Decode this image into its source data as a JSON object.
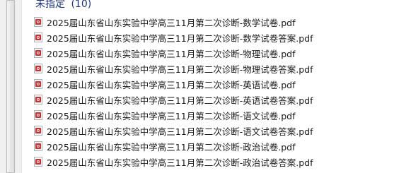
{
  "group": {
    "label": "未指定",
    "count": "(10)"
  },
  "files": [
    {
      "name": "2025届山东省山东实验中学高三11月第二次诊断-数学试卷.pdf",
      "icon": "pdf-file-icon"
    },
    {
      "name": "2025届山东省山东实验中学高三11月第二次诊断-数学试卷答案.pdf",
      "icon": "pdf-file-icon"
    },
    {
      "name": "2025届山东省山东实验中学高三11月第二次诊断-物理试卷.pdf",
      "icon": "pdf-file-icon"
    },
    {
      "name": "2025届山东省山东实验中学高三11月第二次诊断-物理试卷答案.pdf",
      "icon": "pdf-file-icon"
    },
    {
      "name": "2025届山东省山东实验中学高三11月第二次诊断-英语试卷.pdf",
      "icon": "pdf-file-icon"
    },
    {
      "name": "2025届山东省山东实验中学高三11月第二次诊断-英语试卷答案.pdf",
      "icon": "pdf-file-icon"
    },
    {
      "name": "2025届山东省山东实验中学高三11月第二次诊断-语文试卷.pdf",
      "icon": "pdf-file-icon"
    },
    {
      "name": "2025届山东省山东实验中学高三11月第二次诊断-语文试卷答案.pdf",
      "icon": "pdf-file-icon"
    },
    {
      "name": "2025届山东省山东实验中学高三11月第二次诊断-政治试卷.pdf",
      "icon": "pdf-file-icon"
    },
    {
      "name": "2025届山东省山东实验中学高三11月第二次诊断-政治试卷答案.pdf",
      "icon": "pdf-file-icon"
    }
  ],
  "colors": {
    "group_header": "#1e3287",
    "pdf_icon": "#d92b2b",
    "text": "#1a1a1a"
  }
}
